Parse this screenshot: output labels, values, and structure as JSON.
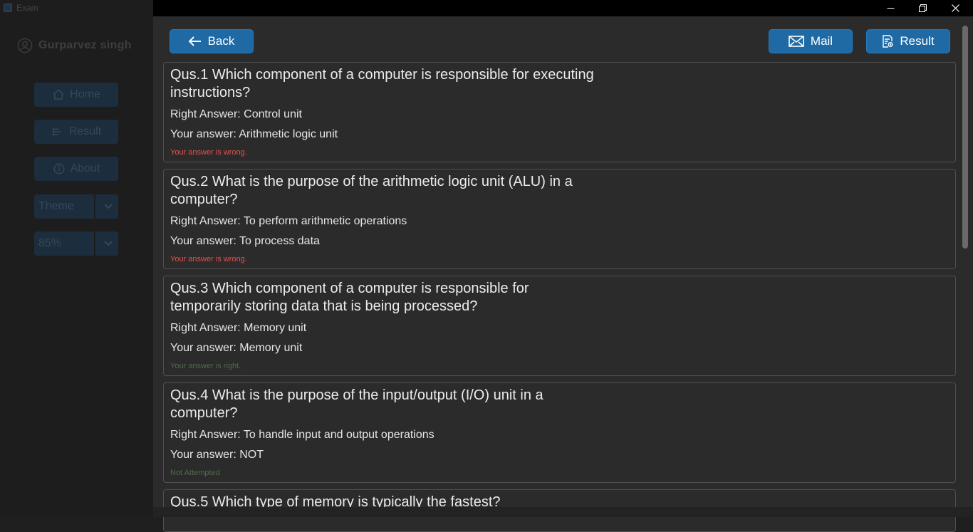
{
  "window": {
    "title": "Exam"
  },
  "sidebar": {
    "user_name": "Gurparvez singh",
    "nav": [
      {
        "label": "Home",
        "icon": "home-icon"
      },
      {
        "label": "Result",
        "icon": "bars-icon"
      },
      {
        "label": "About",
        "icon": "info-icon"
      }
    ],
    "theme_select": {
      "value": "Theme"
    },
    "scale_select": {
      "value": "85%"
    }
  },
  "toolbar": {
    "back_label": "Back",
    "mail_label": "Mail",
    "result_label": "Result"
  },
  "questions": [
    {
      "question": "Qus.1 Which component of a computer is responsible for executing instructions?",
      "right_answer": "Right Answer: Control unit",
      "your_answer": "Your answer: Arithmetic logic unit",
      "status": "Your answer is wrong.",
      "status_color": "#e5504d"
    },
    {
      "question": "Qus.2 What is the purpose of the arithmetic logic unit (ALU) in a computer?",
      "right_answer": "Right Answer: To perform arithmetic operations",
      "your_answer": "Your answer: To process data",
      "status": "Your answer is wrong.",
      "status_color": "#e5504d"
    },
    {
      "question": "Qus.3 Which component of a computer is responsible for temporarily storing data that is being processed?",
      "right_answer": "Right Answer: Memory unit",
      "your_answer": "Your answer: Memory unit",
      "status": "Your answer is right.",
      "status_color": "#4f6b4a"
    },
    {
      "question": "Qus.4 What is the purpose of the input/output (I/O) unit in a computer?",
      "right_answer": "Right Answer: To handle input and output operations",
      "your_answer": "Your answer: NOT",
      "status": "Not Attempted",
      "status_color": "#4f6b4a"
    },
    {
      "question": "Qus.5 Which type of memory is typically the fastest?",
      "right_answer": "",
      "your_answer": "",
      "status": "",
      "status_color": "#4f6b4a"
    }
  ],
  "colors": {
    "accent": "#1f6aa5",
    "wrong": "#e5504d",
    "right": "#4f6b4a"
  }
}
